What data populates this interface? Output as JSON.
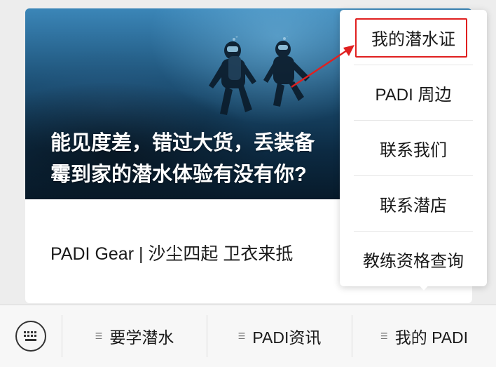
{
  "article": {
    "banner_title_line1": "能见度差，错过大货，丢装备",
    "banner_title_line2": "霉到家的潜水体验有没有你?",
    "title": "PADI Gear | 沙尘四起 卫衣来抵"
  },
  "popup_menu": {
    "items": [
      {
        "label": "我的潜水证"
      },
      {
        "label": "PADI 周边"
      },
      {
        "label": "联系我们"
      },
      {
        "label": "联系潜店"
      },
      {
        "label": "教练资格查询"
      }
    ],
    "highlighted_index": 0,
    "highlight_color": "#e02020"
  },
  "bottom_bar": {
    "keyboard_icon": "keyboard-icon",
    "tabs": [
      {
        "label": "要学潜水",
        "icon": "menu-lines-icon"
      },
      {
        "label": "PADI资讯",
        "icon": "menu-lines-icon"
      },
      {
        "label": "我的 PADI",
        "icon": "menu-lines-icon"
      }
    ]
  }
}
